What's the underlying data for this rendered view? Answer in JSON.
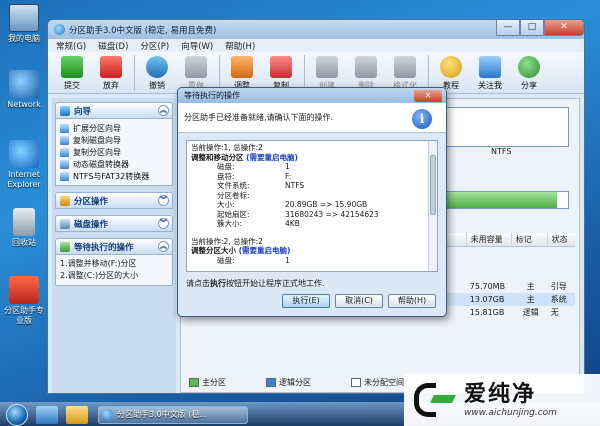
{
  "desktop": {
    "icons": [
      {
        "label": "我的电脑"
      },
      {
        "label": "Network"
      },
      {
        "label": "Internet Explorer"
      },
      {
        "label": "回收站"
      },
      {
        "label": "分区助手专业版"
      }
    ]
  },
  "window": {
    "title": "分区助手3.0中文版 (稳定, 易用且免费)",
    "controls": {
      "minimize": "—",
      "maximize": "□",
      "close": "✕"
    },
    "menu": [
      "常规(G)",
      "磁盘(D)",
      "分区(P)",
      "向导(W)",
      "帮助(H)"
    ],
    "toolbar": [
      {
        "label": "提交",
        "icon": "check-icon",
        "disabled": false
      },
      {
        "label": "放弃",
        "icon": "discard-icon",
        "disabled": false
      },
      {
        "label": "撤销",
        "icon": "undo-icon",
        "disabled": false
      },
      {
        "label": "重做",
        "icon": "redo-icon",
        "disabled": true
      },
      {
        "label": "调整",
        "icon": "adjust-icon",
        "disabled": false
      },
      {
        "label": "复制",
        "icon": "copy-icon",
        "disabled": false
      },
      {
        "label": "创建",
        "icon": "create-icon",
        "disabled": true
      },
      {
        "label": "删除",
        "icon": "delete-icon",
        "disabled": true
      },
      {
        "label": "格式化",
        "icon": "format-icon",
        "disabled": true
      },
      {
        "label": "教程",
        "icon": "tutorial-icon",
        "disabled": false
      },
      {
        "label": "关注我",
        "icon": "follow-icon",
        "disabled": false
      },
      {
        "label": "分享",
        "icon": "share-icon",
        "disabled": false
      }
    ]
  },
  "sidebar": {
    "wizard_title": "向导",
    "wizard_items": [
      "扩展分区向导",
      "复制磁盘向导",
      "复制分区向导",
      "动态磁盘转换器",
      "NTFS与FAT32转换器"
    ],
    "partition_ops_title": "分区操作",
    "disk_ops_title": "磁盘操作",
    "pending_title": "等待执行的操作",
    "pending_items": [
      "1.调整并移动(F:)分区",
      "2.调整(C:)分区的大小"
    ]
  },
  "main": {
    "partial_fs": "NTFS",
    "columns": [
      "未用容量",
      "标记",
      "状态"
    ],
    "rows": [
      {
        "free": "75.70MB",
        "flag": "主",
        "status": "引导",
        "selected": false
      },
      {
        "free": "13.07GB",
        "flag": "主",
        "status": "系统",
        "selected": true
      },
      {
        "free": "15.81GB",
        "flag": "逻辑",
        "status": "无",
        "selected": false
      }
    ],
    "disk_fill": 0.97,
    "legend": [
      "主分区",
      "逻辑分区",
      "未分配空间"
    ]
  },
  "dialog": {
    "title": "等待执行的操作",
    "close": "✕",
    "banner": "分区助手已经准备就绪,请确认下面的操作.",
    "info_icon": "i",
    "operations": [
      {
        "head": "当前操作:1, 总操作:2",
        "name": "调整和移动分区",
        "warn": "(需要重启电脑)",
        "details": [
          {
            "k": "磁盘:",
            "v": "1"
          },
          {
            "k": "盘符:",
            "v": "F:"
          },
          {
            "k": "文件系统:",
            "v": "NTFS"
          },
          {
            "k": "分区卷标:",
            "v": ""
          },
          {
            "k": "大小:",
            "v": "20.89GB => 15.90GB"
          },
          {
            "k": "起始扇区:",
            "v": "31680243 => 42154623"
          },
          {
            "k": "簇大小:",
            "v": "4KB"
          }
        ]
      },
      {
        "head": "当前操作:2, 总操作:2",
        "name": "调整分区大小",
        "warn": "(需要重启电脑)",
        "details": [
          {
            "k": "磁盘:",
            "v": "1"
          }
        ]
      }
    ],
    "hint_pre": "请点击",
    "hint_bold": "执行",
    "hint_post": "按钮开始让程序正式地工作.",
    "buttons": {
      "execute": "执行(E)",
      "cancel": "取消(C)",
      "help": "帮助(H)"
    }
  },
  "taskbar": {
    "task_label": "分区助手3.0中文版 (稳..."
  },
  "watermark": {
    "big": "爱纯净",
    "small": "www.aichunjing.com"
  }
}
